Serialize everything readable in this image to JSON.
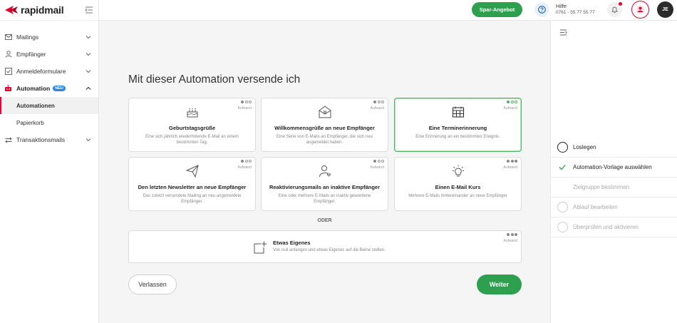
{
  "brand": {
    "name": "rapidmail",
    "accent": "#e4002b",
    "green": "#2e9e4f"
  },
  "sidebar": {
    "items": [
      {
        "label": "Mailings",
        "icon": "envelope-icon"
      },
      {
        "label": "Empfänger",
        "icon": "user-icon"
      },
      {
        "label": "Anmeldeformulare",
        "icon": "form-check-icon"
      },
      {
        "label": "Automation",
        "icon": "robot-icon",
        "badge": "NEU",
        "expanded": true
      },
      {
        "label": "Transaktionsmails",
        "icon": "arrows-exchange-icon"
      }
    ],
    "subitems": [
      {
        "label": "Automationen",
        "selected": true
      },
      {
        "label": "Papierkorb",
        "selected": false
      }
    ]
  },
  "topbar": {
    "offer_label": "Spar-Angebot",
    "help_title": "Hilfe",
    "help_phone": "0761 - 55 77 55 77",
    "avatar_initials": "JE"
  },
  "main": {
    "heading": "Mit dieser Automation versende ich",
    "effort_label": "Aufwand",
    "cards": [
      {
        "title": "Geburtstagsgrüße",
        "desc": "Eine sich jährlich wiederholende E-Mail an einem bestimmten Tag.",
        "icon": "birthday-cake-icon",
        "effort": 1,
        "selected": false
      },
      {
        "title": "Willkommensgrüße an neue Empfänger",
        "desc": "Eine Serie von E-Mails an Empfänger, die sich neu angemeldet haben.",
        "icon": "welcome-envelope-icon",
        "effort": 1,
        "selected": false
      },
      {
        "title": "Eine Terminerinnerung",
        "desc": "Eine Erinnerung an ein bestimmtes Ereignis.",
        "icon": "calendar-icon",
        "effort": 1,
        "selected": true
      },
      {
        "title": "Den letzten Newsletter an neue Empfänger",
        "desc": "Das zuletzt versendete Mailing an neu angemeldete Empfänger.",
        "icon": "paper-plane-icon",
        "effort": 1,
        "selected": false
      },
      {
        "title": "Reaktivierungsmails an inaktive Empfänger",
        "desc": "Eine oder mehrere E-Mails an inaktiv gewordene Empfänger.",
        "icon": "user-heart-icon",
        "effort": 1,
        "selected": false
      },
      {
        "title": "Einen E-Mail Kurs",
        "desc": "Mehrere E-Mails hintereinander an neue Empfänger",
        "icon": "lightbulb-icon",
        "effort": 3,
        "selected": false
      }
    ],
    "divider": "ODER",
    "own": {
      "title": "Etwas Eigenes",
      "desc": "Von null anfangen und etwas Eigenes auf die Beine stellen.",
      "icon": "square-plus-icon",
      "effort": 3
    },
    "leave_label": "Verlassen",
    "next_label": "Weiter"
  },
  "steps": [
    {
      "label": "Loslegen",
      "state": "current"
    },
    {
      "label": "Automation-Vorlage auswählen",
      "state": "done"
    },
    {
      "label": "Zielgruppe bestimmen",
      "state": "pending-noicon"
    },
    {
      "label": "Ablauf bearbeiten",
      "state": "pending"
    },
    {
      "label": "Überprüfen und aktivieren",
      "state": "pending"
    }
  ]
}
